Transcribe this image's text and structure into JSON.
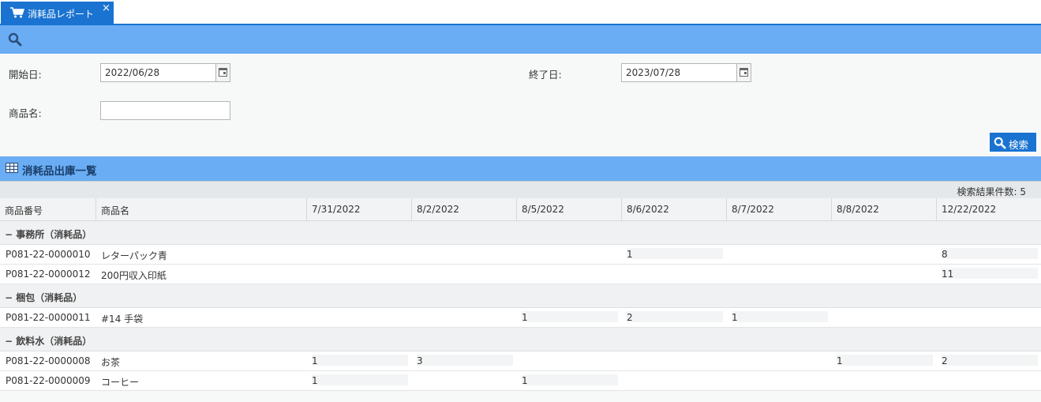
{
  "tab": {
    "label": "消耗品レポート",
    "close": "×"
  },
  "filter": {
    "start_label": "開始日:",
    "start_value": "2022/06/28",
    "end_label": "終了日:",
    "end_value": "2023/07/28",
    "product_label": "商品名:",
    "product_value": "",
    "search_label": "検索"
  },
  "list": {
    "title": "消耗品出庫一覧",
    "count_text": "検索結果件数:",
    "count_value": "5"
  },
  "columns": [
    "商品番号",
    "商品名",
    "7/31/2022",
    "8/2/2022",
    "8/5/2022",
    "8/6/2022",
    "8/7/2022",
    "8/8/2022",
    "12/22/2022"
  ],
  "groups": [
    {
      "name": "− 事務所（消耗品）",
      "rows": [
        {
          "code": "P081-22-0000010",
          "name": "レターパック青",
          "values": [
            "",
            "",
            "",
            "1",
            "",
            "",
            "8"
          ]
        },
        {
          "code": "P081-22-0000012",
          "name": "200円収入印紙",
          "values": [
            "",
            "",
            "",
            "",
            "",
            "",
            "11"
          ]
        }
      ]
    },
    {
      "name": "− 梱包（消耗品）",
      "rows": [
        {
          "code": "P081-22-0000011",
          "name": "#14 手袋",
          "values": [
            "",
            "",
            "1",
            "2",
            "1",
            "",
            ""
          ]
        }
      ]
    },
    {
      "name": "− 飲料水（消耗品）",
      "rows": [
        {
          "code": "P081-22-0000008",
          "name": "お茶",
          "values": [
            "1",
            "3",
            "",
            "",
            "",
            "1",
            "2"
          ]
        },
        {
          "code": "P081-22-0000009",
          "name": "コーヒー",
          "values": [
            "1",
            "",
            "1",
            "",
            "",
            "",
            ""
          ]
        }
      ]
    }
  ],
  "colors": {
    "tab": "#1a73d1",
    "header_bar": "#6aadf4",
    "button": "#1a73d1"
  }
}
